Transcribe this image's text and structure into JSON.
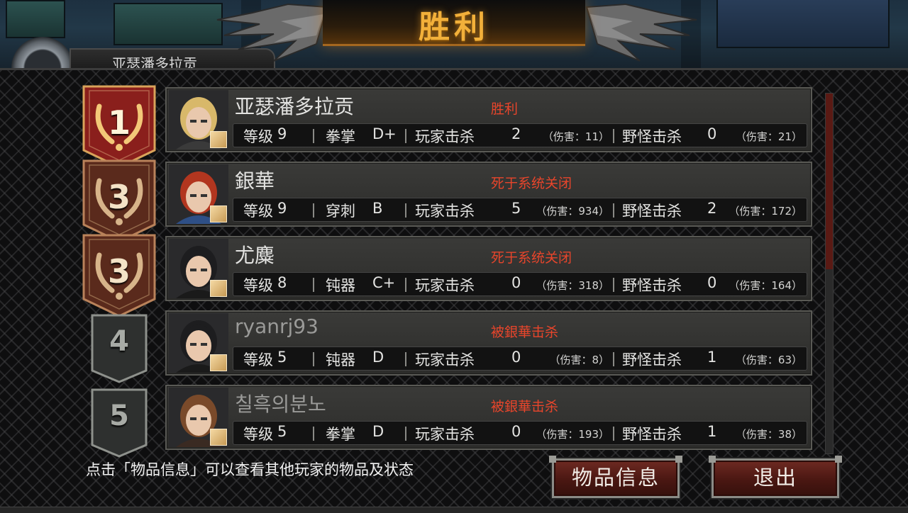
{
  "title": "胜利",
  "top_profile": {
    "name": "亚瑟潘多拉贡"
  },
  "rows": [
    {
      "rank": "1",
      "name": "亚瑟潘多拉贡",
      "name_dim": false,
      "status": "胜利",
      "level_label": "等级",
      "level": "9",
      "weapon": "拳掌",
      "grade": "D+",
      "player_kill_label": "玩家击杀",
      "player_kills": "2",
      "player_dmg": "（伤害：11）",
      "monster_kill_label": "野怪击杀",
      "monster_kills": "0",
      "monster_dmg": "（伤害：21）",
      "badge": "gold",
      "hair": "#d8b86a",
      "outfit": "#3a3a3a"
    },
    {
      "rank": "3",
      "name": "銀華",
      "name_dim": false,
      "status": "死于系统关闭",
      "level_label": "等级",
      "level": "9",
      "weapon": "穿刺",
      "grade": "B",
      "player_kill_label": "玩家击杀",
      "player_kills": "5",
      "player_dmg": "（伤害：934）",
      "monster_kill_label": "野怪击杀",
      "monster_kills": "2",
      "monster_dmg": "（伤害：172）",
      "badge": "bronze",
      "hair": "#b2361f",
      "outfit": "#2e4f86"
    },
    {
      "rank": "3",
      "name": "尤麋",
      "name_dim": false,
      "status": "死于系统关闭",
      "level_label": "等级",
      "level": "8",
      "weapon": "钝器",
      "grade": "C+",
      "player_kill_label": "玩家击杀",
      "player_kills": "0",
      "player_dmg": "（伤害：318）",
      "monster_kill_label": "野怪击杀",
      "monster_kills": "0",
      "monster_dmg": "（伤害：164）",
      "badge": "bronze",
      "hair": "#1d1d1f",
      "outfit": "#1a1a1a"
    },
    {
      "rank": "4",
      "name": "ryanrj93",
      "name_dim": true,
      "status": "被銀華击杀",
      "level_label": "等级",
      "level": "5",
      "weapon": "钝器",
      "grade": "D",
      "player_kill_label": "玩家击杀",
      "player_kills": "0",
      "player_dmg": "（伤害：8）",
      "monster_kill_label": "野怪击杀",
      "monster_kills": "1",
      "monster_dmg": "（伤害：63）",
      "badge": "grey",
      "hair": "#1d1d1f",
      "outfit": "#1a1a1a"
    },
    {
      "rank": "5",
      "name": "칠흑의분노",
      "name_dim": true,
      "status": "被銀華击杀",
      "level_label": "等级",
      "level": "5",
      "weapon": "拳掌",
      "grade": "D",
      "player_kill_label": "玩家击杀",
      "player_kills": "0",
      "player_dmg": "（伤害：193）",
      "monster_kill_label": "野怪击杀",
      "monster_kills": "1",
      "monster_dmg": "（伤害：38）",
      "badge": "grey",
      "hair": "#7a4a2a",
      "outfit": "#3a2a22"
    }
  ],
  "footer": {
    "hint": "点击「物品信息」可以查看其他玩家的物品及状态",
    "items_button": "物品信息",
    "exit_button": "退出"
  }
}
